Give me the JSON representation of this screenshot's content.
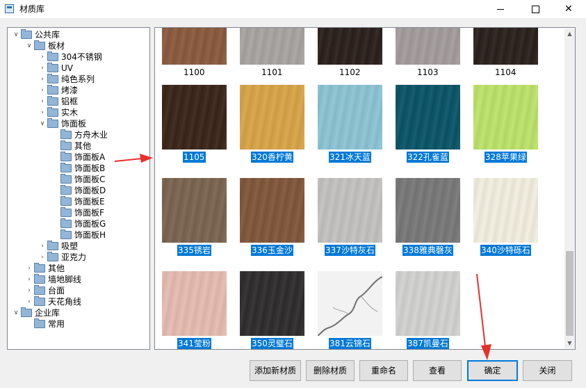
{
  "window": {
    "title": "材质库",
    "minimize_glyph": "",
    "maximize_glyph": "",
    "close_glyph": "✕"
  },
  "tree": {
    "expanded_glyph": "∨",
    "collapsed_glyph": "›",
    "items": [
      {
        "label": "公共库",
        "level": 0,
        "expander": "expanded"
      },
      {
        "label": "板材",
        "level": 1,
        "expander": "expanded"
      },
      {
        "label": "304不锈钢",
        "level": 2,
        "expander": "collapsed"
      },
      {
        "label": "UV",
        "level": 2,
        "expander": "collapsed"
      },
      {
        "label": "纯色系列",
        "level": 2,
        "expander": "collapsed"
      },
      {
        "label": "烤漆",
        "level": 2,
        "expander": "collapsed"
      },
      {
        "label": "铝框",
        "level": 2,
        "expander": "collapsed"
      },
      {
        "label": "实木",
        "level": 2,
        "expander": "collapsed"
      },
      {
        "label": "饰面板",
        "level": 2,
        "expander": "expanded"
      },
      {
        "label": "方舟木业",
        "level": 3,
        "expander": "none"
      },
      {
        "label": "其他",
        "level": 3,
        "expander": "none"
      },
      {
        "label": "饰面板A",
        "level": 3,
        "expander": "none"
      },
      {
        "label": "饰面板B",
        "level": 3,
        "expander": "none"
      },
      {
        "label": "饰面板C",
        "level": 3,
        "expander": "none"
      },
      {
        "label": "饰面板D",
        "level": 3,
        "expander": "none"
      },
      {
        "label": "饰面板E",
        "level": 3,
        "expander": "none"
      },
      {
        "label": "饰面板F",
        "level": 3,
        "expander": "none"
      },
      {
        "label": "饰面板G",
        "level": 3,
        "expander": "none"
      },
      {
        "label": "饰面板H",
        "level": 3,
        "expander": "none"
      },
      {
        "label": "吸塑",
        "level": 2,
        "expander": "collapsed"
      },
      {
        "label": "亚克力",
        "level": 2,
        "expander": "collapsed"
      },
      {
        "label": "其他",
        "level": 1,
        "expander": "collapsed"
      },
      {
        "label": "墙地脚线",
        "level": 1,
        "expander": "collapsed"
      },
      {
        "label": "台面",
        "level": 1,
        "expander": "collapsed"
      },
      {
        "label": "天花角线",
        "level": 1,
        "expander": "collapsed"
      },
      {
        "label": "企业库",
        "level": 0,
        "expander": "expanded"
      },
      {
        "label": "常用",
        "level": 1,
        "expander": "none"
      }
    ]
  },
  "materials": [
    {
      "label": "1100",
      "selected": false,
      "color": "#8a5a3e"
    },
    {
      "label": "1101",
      "selected": false,
      "color": "#a8a4a2"
    },
    {
      "label": "1102",
      "selected": false,
      "color": "#2a1f1b"
    },
    {
      "label": "1103",
      "selected": false,
      "color": "#a49c9c"
    },
    {
      "label": "1104",
      "selected": false,
      "color": "#2a201c"
    },
    {
      "label": "1105",
      "selected": true,
      "color": "#3a2418"
    },
    {
      "label": "320香柠黄",
      "selected": true,
      "color": "#d8a446"
    },
    {
      "label": "321冰天蓝",
      "selected": true,
      "color": "#8cc4d4"
    },
    {
      "label": "322孔雀蓝",
      "selected": true,
      "color": "#0a5468"
    },
    {
      "label": "328苹果绿",
      "selected": true,
      "color": "#bde36a"
    },
    {
      "label": "335锈岩",
      "selected": true,
      "color": "#7a6450"
    },
    {
      "label": "336玉金沙",
      "selected": true,
      "color": "#80563a"
    },
    {
      "label": "337沙特灰石",
      "selected": true,
      "color": "#c4c2c0"
    },
    {
      "label": "338雅典磬灰",
      "selected": true,
      "color": "#787878"
    },
    {
      "label": "340沙特砾石",
      "selected": true,
      "color": "#f2efe0"
    },
    {
      "label": "341莹粉",
      "selected": true,
      "color": "#e6bcb0"
    },
    {
      "label": "350灵璧石",
      "selected": true,
      "color": "#2e2c2c"
    },
    {
      "label": "381云锦石",
      "selected": true,
      "color": "#f2f2f2"
    },
    {
      "label": "387凯曼石",
      "selected": true,
      "color": "#d2d2d0"
    }
  ],
  "scrollbar": {
    "up_glyph": "▲",
    "down_glyph": "▼"
  },
  "buttons": {
    "add": "添加新材质",
    "delete": "删除材质",
    "rename": "重命名",
    "view": "查看",
    "ok": "确定",
    "close": "关闭"
  },
  "colors": {
    "selection": "#0078d7",
    "annotation_arrow": "#e8302b"
  }
}
